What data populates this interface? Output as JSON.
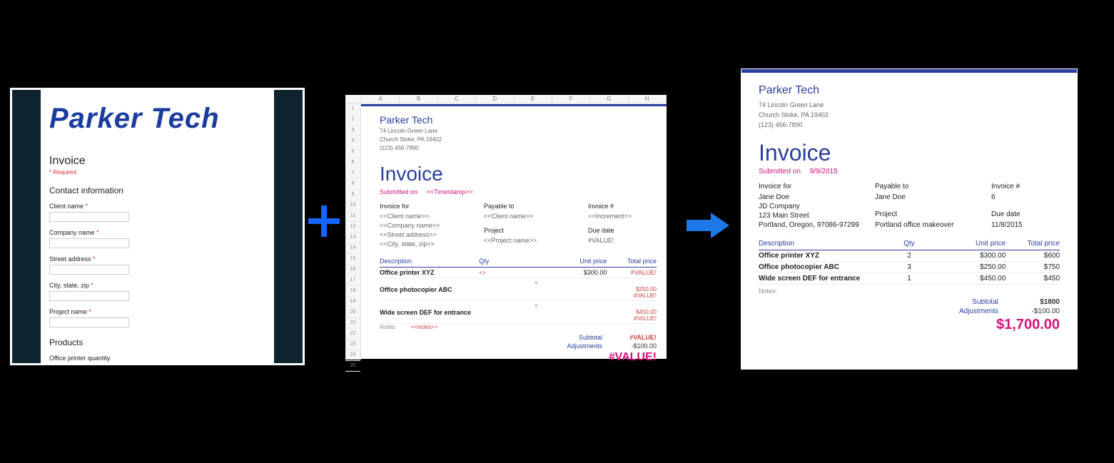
{
  "company": {
    "name": "Parker Tech",
    "addr1": "74 Lincoln Green Lane",
    "addr2": "Church Stoke, PA 19402",
    "phone": "(123) 456-7890"
  },
  "form": {
    "logo": "Parker Tech",
    "title": "Invoice",
    "required_note": "* Required",
    "section_contact": "Contact information",
    "fields": {
      "client": "Client name",
      "company": "Company name",
      "street": "Street address",
      "city": "City, state, zip",
      "project": "Project name"
    },
    "section_products": "Products",
    "product_field": "Office printer quantity",
    "asterisk": "*"
  },
  "sheet": {
    "cols": [
      "A",
      "B",
      "C",
      "D",
      "E",
      "F",
      "G",
      "H"
    ],
    "rows": [
      "1",
      "2",
      "3",
      "4",
      "5",
      "6",
      "7",
      "8",
      "9",
      "10",
      "11",
      "12",
      "13",
      "14",
      "15",
      "16",
      "17",
      "18",
      "19",
      "20",
      "21",
      "22",
      "23",
      "24",
      "25"
    ],
    "heading": "Invoice",
    "submitted_label": "Submitted on",
    "submitted_value": "<<Timestamp>>",
    "meta": {
      "invoice_for": "Invoice for",
      "payable_to": "Payable to",
      "invoice_num": "Invoice #",
      "project": "Project",
      "due_date": "Due date",
      "client_ph": "<<Client name>>",
      "company_ph": "<<Company name>>",
      "street_ph": "<<Street address>>",
      "city_ph": "<<City, state, zip>>",
      "payable_ph": "<<Client name>>",
      "project_ph": "<<Project name>>",
      "increment_ph": "<<Increment>>",
      "due_err": "#VALUE!"
    },
    "table": {
      "h_desc": "Description",
      "h_qty": "Qty",
      "h_unit": "Unit price",
      "h_total": "Total price",
      "rows": [
        {
          "d": "Office printer XYZ",
          "q": "<<Office printer quantity>>",
          "u": "$300.00",
          "t": "#VALUE!"
        },
        {
          "d": "Office photocopier ABC",
          "q": "<<Office photocopier qua",
          "u": "$250.00",
          "t": "#VALUE!"
        },
        {
          "d": "Wide screen DEF for entrance",
          "q": "<<Wide screen DEF quanti",
          "u": "$450.00",
          "t": "#VALUE!"
        }
      ],
      "subtotal_l": "Subtotal",
      "subtotal_v": "#VALUE!",
      "adj_l": "Adjustments",
      "adj_v": "-$100.00",
      "grand": "#VALUE!",
      "notes_l": "Notes:",
      "notes_v": "<<notes>>"
    }
  },
  "output": {
    "heading": "Invoice",
    "submitted_label": "Submitted on",
    "submitted_value": "9/9/2015",
    "meta": {
      "invoice_for": "Invoice for",
      "payable_to": "Payable to",
      "invoice_num": "Invoice #",
      "project": "Project",
      "due_date": "Due date",
      "client": "Jane Doe",
      "company": "JD Company",
      "street": "123 Main Street",
      "city": "Portland, Oregon, 97086-97299",
      "payable": "Jane Doe",
      "project_v": "Portland office makeover",
      "number": "6",
      "due": "11/8/2015"
    },
    "table": {
      "h_desc": "Description",
      "h_qty": "Qty",
      "h_unit": "Unit price",
      "h_total": "Total price",
      "rows": [
        {
          "d": "Office printer XYZ",
          "q": "2",
          "u": "$300.00",
          "t": "$600"
        },
        {
          "d": "Office photocopier ABC",
          "q": "3",
          "u": "$250.00",
          "t": "$750"
        },
        {
          "d": "Wide screen DEF for entrance",
          "q": "1",
          "u": "$450.00",
          "t": "$450"
        }
      ],
      "subtotal_l": "Subtotal",
      "subtotal_v": "$1800",
      "adj_l": "Adjustments",
      "adj_v": "-$100.00",
      "grand": "$1,700.00",
      "notes_l": "Notes:"
    }
  }
}
